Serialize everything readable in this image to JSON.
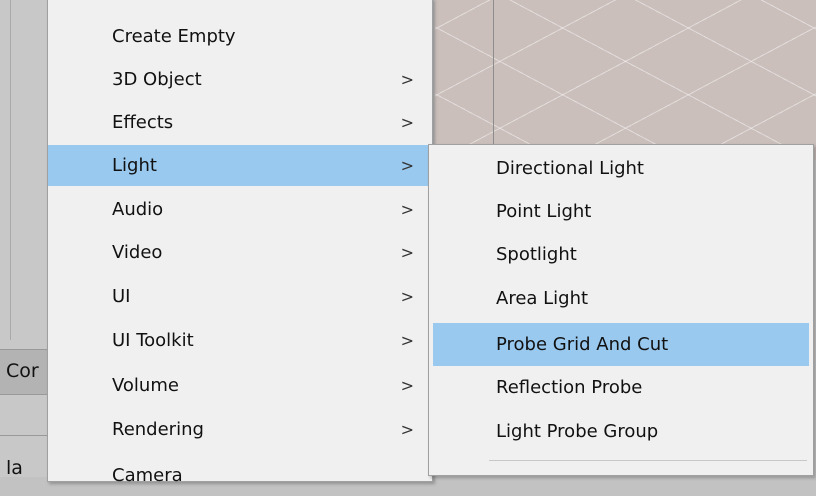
{
  "background": {
    "left_pane_text_upper": "Cor",
    "left_pane_text_lower": "la"
  },
  "main_menu": {
    "items": [
      {
        "label": "Create Empty",
        "submenu": false
      },
      {
        "label": "3D Object",
        "submenu": true
      },
      {
        "label": "Effects",
        "submenu": true
      },
      {
        "label": "Light",
        "submenu": true,
        "highlighted": true
      },
      {
        "label": "Audio",
        "submenu": true
      },
      {
        "label": "Video",
        "submenu": true
      },
      {
        "label": "UI",
        "submenu": true
      },
      {
        "label": "UI Toolkit",
        "submenu": true
      },
      {
        "label": "Volume",
        "submenu": true
      },
      {
        "label": "Rendering",
        "submenu": true
      },
      {
        "label": "Camera",
        "submenu": false
      }
    ],
    "arrow_glyph": ">"
  },
  "light_submenu": {
    "items": [
      {
        "label": "Directional Light"
      },
      {
        "label": "Point Light"
      },
      {
        "label": "Spotlight"
      },
      {
        "label": "Area Light"
      },
      {
        "label": "Probe Grid And Cut",
        "highlighted": true
      },
      {
        "label": "Reflection Probe"
      },
      {
        "label": "Light Probe Group"
      }
    ]
  },
  "colors": {
    "menu_background": "#f0f0f0",
    "highlight": "#99c9ef",
    "scene_floor": "#cbbfbb"
  }
}
